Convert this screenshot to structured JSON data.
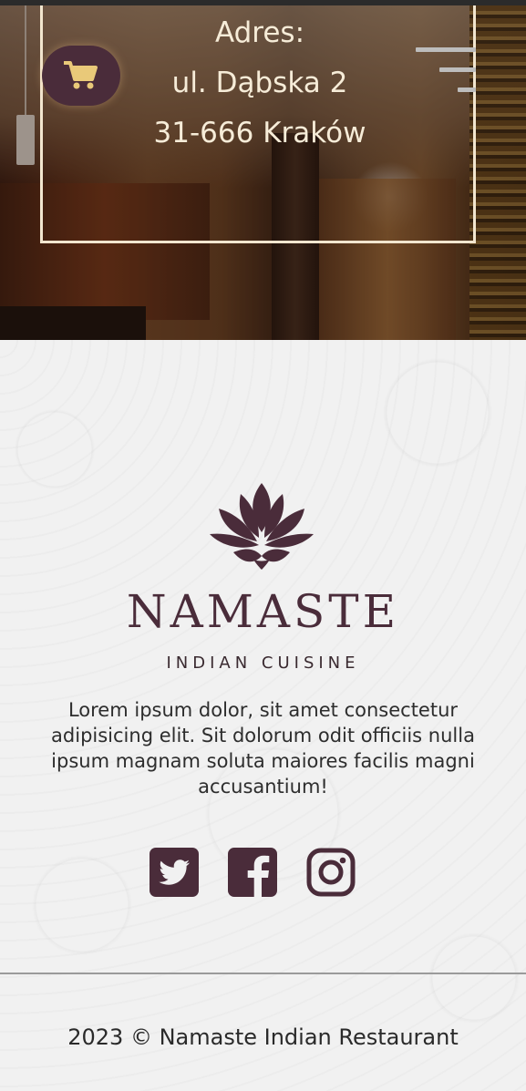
{
  "hero": {
    "address": {
      "heading": "Adres:",
      "street": "ul. Dąbska 2",
      "city": "31-666 Kraków"
    }
  },
  "nav": {
    "cart_icon": "cart-icon",
    "menu_icon": "hamburger-menu-icon"
  },
  "footer": {
    "brand_name": "NAMASTE",
    "brand_tagline": "INDIAN CUISINE",
    "description": "Lorem ipsum dolor, sit amet consectetur adipisicing elit. Sit dolorum odit officiis nulla ipsum magnam soluta maiores facilis magni accusantium!",
    "social": [
      "twitter-icon",
      "facebook-icon",
      "instagram-icon"
    ],
    "copyright": "2023 © Namaste Indian Restaurant"
  },
  "colors": {
    "brand": "#4a2c3a",
    "accent": "#e9c979",
    "frame": "#f2e6cf"
  }
}
